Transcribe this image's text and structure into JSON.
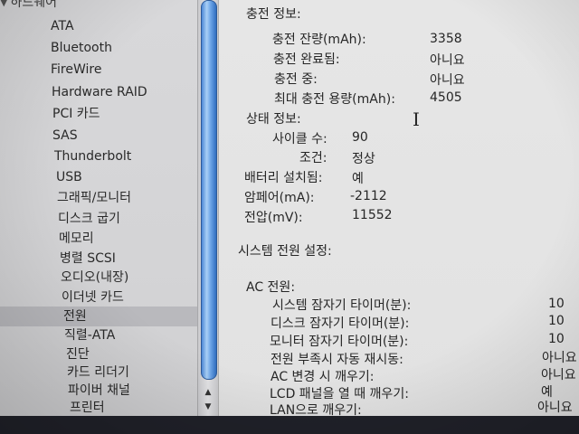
{
  "sidebar": {
    "header": "하드웨어",
    "items": [
      {
        "label": "ATA"
      },
      {
        "label": "Bluetooth"
      },
      {
        "label": "FireWire"
      },
      {
        "label": "Hardware RAID"
      },
      {
        "label": "PCI 카드"
      },
      {
        "label": "SAS"
      },
      {
        "label": "Thunderbolt"
      },
      {
        "label": "USB"
      },
      {
        "label": "그래픽/모니터"
      },
      {
        "label": "디스크 굽기"
      },
      {
        "label": "메모리"
      },
      {
        "label": "병렬 SCSI"
      },
      {
        "label": "오디오(내장)"
      },
      {
        "label": "이더넷 카드"
      },
      {
        "label": "전원",
        "selected": true
      },
      {
        "label": "직렬-ATA"
      },
      {
        "label": "진단"
      },
      {
        "label": "카드 리더기"
      },
      {
        "label": "파이버 채널"
      },
      {
        "label": "프린터"
      }
    ]
  },
  "scrollbar": {
    "up_arrow": "▲",
    "down_arrow": "▼"
  },
  "charge_info": {
    "title": "충전 정보:",
    "rows": [
      {
        "label": "충전 잔량(mAh):",
        "value": "3358"
      },
      {
        "label": "충전 완료됨:",
        "value": "아니요"
      },
      {
        "label": "충전 중:",
        "value": "아니요"
      },
      {
        "label": "최대 충전 용량(mAh):",
        "value": "4505"
      }
    ]
  },
  "status_info": {
    "title": "상태 정보:",
    "rows": [
      {
        "label": "사이클 수:",
        "value": "90"
      },
      {
        "label": "조건:",
        "value": "정상"
      }
    ]
  },
  "battery": {
    "installed_label": "배터리 설치됨:",
    "installed_value": "예",
    "amperage_label": "암페어(mA):",
    "amperage_value": "-2112",
    "voltage_label": "전압(mV):",
    "voltage_value": "11552"
  },
  "system_power": {
    "title": "시스템 전원 설정:",
    "ac_title": "AC 전원:",
    "rows": [
      {
        "label": "시스템 잠자기 타이머(분):",
        "value": "10"
      },
      {
        "label": "디스크 잠자기 타이머(분):",
        "value": "10"
      },
      {
        "label": "모니터 잠자기 타이머(분):",
        "value": "10"
      },
      {
        "label": "전원 부족시 자동 재시동:",
        "value": "아니요"
      },
      {
        "label": "AC 변경 시 깨우기:",
        "value": "아니요"
      },
      {
        "label": "LCD 패널을 열 때 깨우기:",
        "value": "예"
      },
      {
        "label": "LAN으로 깨우기:",
        "value": "아니요"
      }
    ]
  },
  "cursor_glyph": "I"
}
